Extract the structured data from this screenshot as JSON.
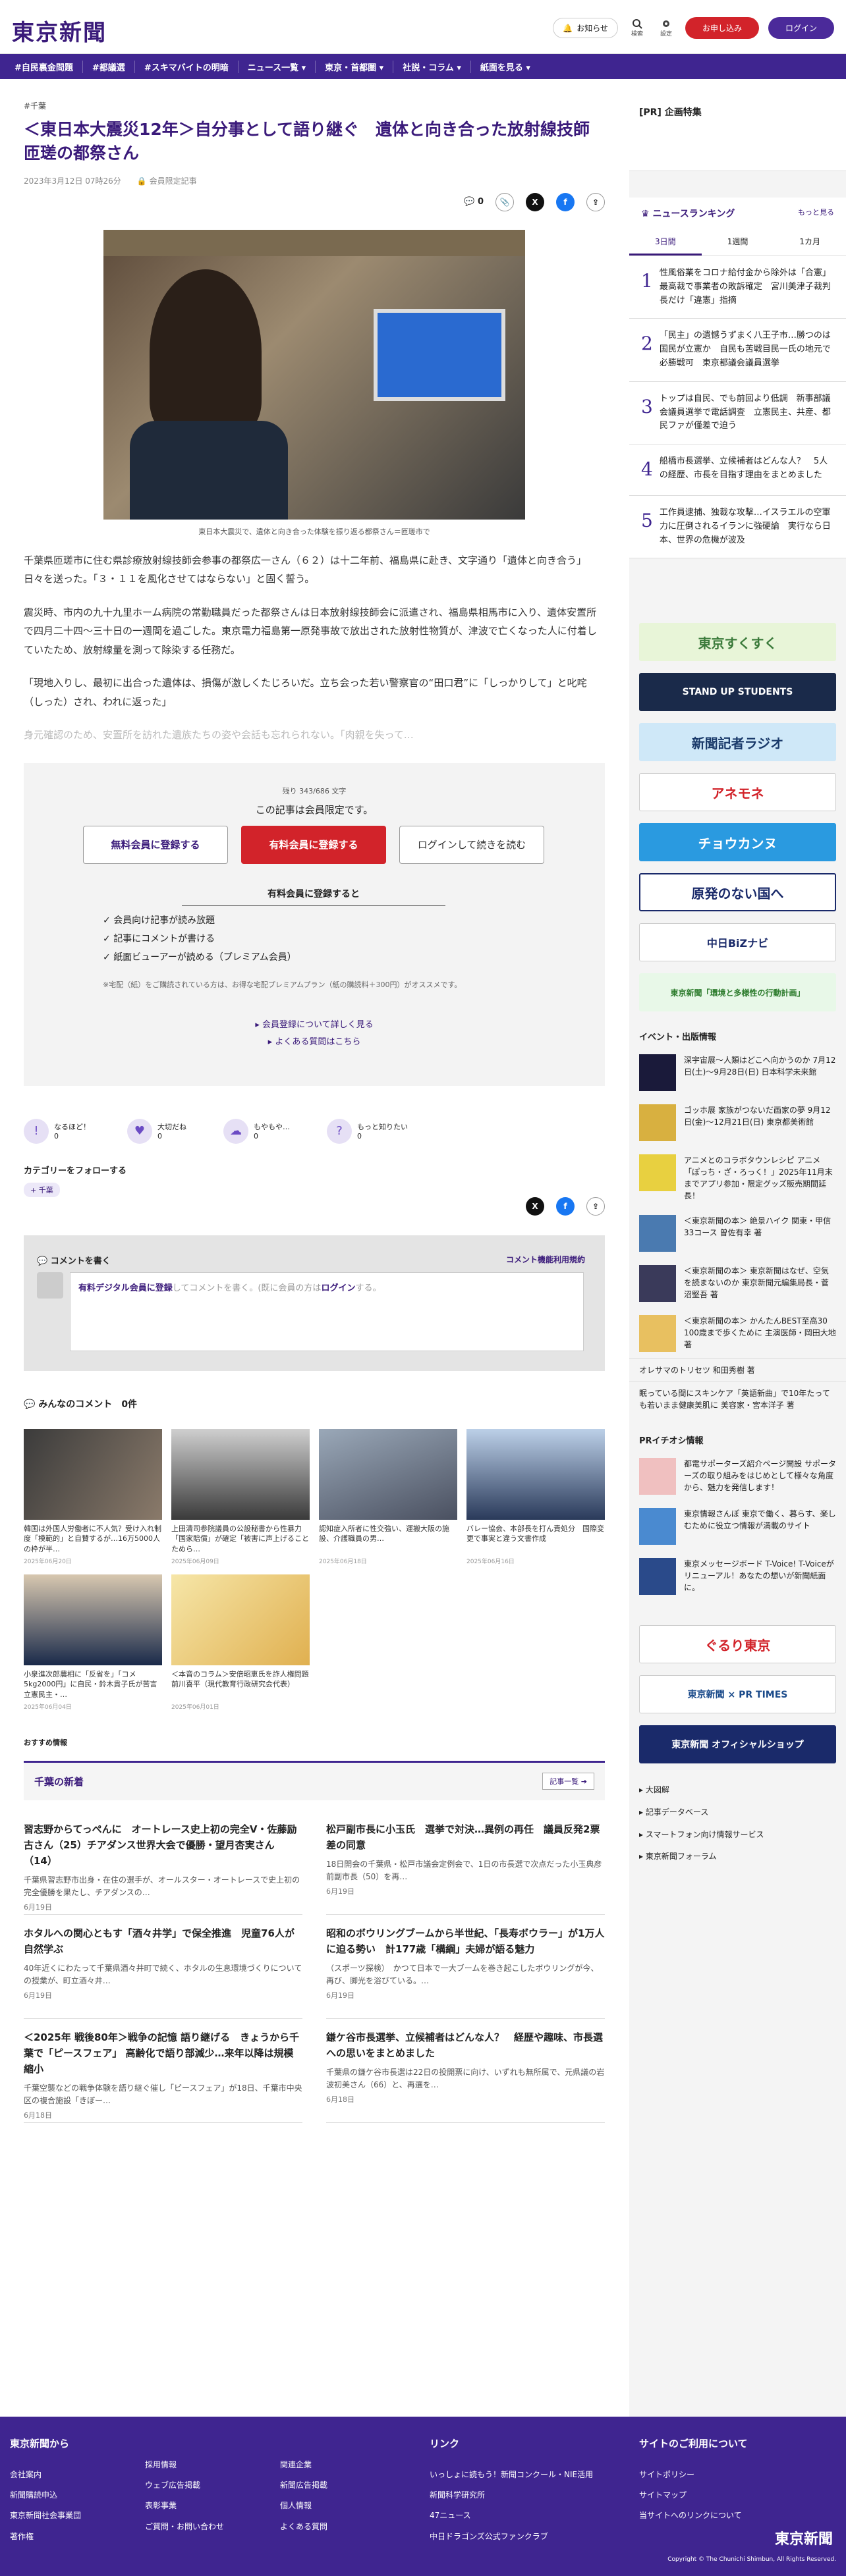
{
  "header": {
    "logo": "東京新聞",
    "notice": "お知らせ",
    "search": "検索",
    "settings": "設定",
    "register": "お申し込み",
    "login": "ログイン"
  },
  "nav": [
    "#自民裏金問題",
    "#都議選",
    "#スキマバイトの明暗",
    "ニュース一覧 ▾",
    "東京・首都圏 ▾",
    "社説・コラム ▾",
    "紙面を見る ▾"
  ],
  "article": {
    "tag": "#千葉",
    "title": "＜東日本大震災12年＞自分事として語り継ぐ　遺体と向き合った放射線技師　匝瑳の都祭さん",
    "date": "2023年3月12日 07時26分",
    "members": "会員限定記事",
    "comments": "0",
    "caption": "東日本大震災で、遺体と向き合った体験を振り返る都祭さん＝匝瑳市で",
    "p1": "千葉県匝瑳市に住む県診療放射線技師会参事の都祭広一さん（６２）は十二年前、福島県に赴き、文字通り「遺体と向き合う」日々を送った。「３・１１を風化させてはならない」と固く誓う。",
    "p2": "震災時、市内の九十九里ホーム病院の常勤職員だった都祭さんは日本放射線技師会に派遣され、福島県相馬市に入り、遺体安置所で四月二十四〜三十日の一週間を過ごした。東京電力福島第一原発事故で放出された放射性物質が、津波で亡くなった人に付着していたため、放射線量を測って除染する任務だ。",
    "p3": "「現地入りし、最初に出合った遺体は、損傷が激しくたじろいだ。立ち会った若い警察官の“田口君”に「しっかりして」と叱咤（しった）され、われに返った」",
    "p4": "身元確認のため、安置所を訪れた遺族たちの姿や会話も忘れられない。「肉親を失って…"
  },
  "paywall": {
    "remaining": "残り 343/686 文字",
    "notice": "この記事は会員限定です。",
    "free": "無料会員に登録する",
    "paid": "有料会員に登録する",
    "login": "ログインして続きを読む",
    "benefits_title": "有料会員に登録すると",
    "benefits": [
      "会員向け記事が読み放題",
      "記事にコメントが書ける",
      "紙面ビューアーが読める（プレミアム会員）"
    ],
    "note": "※宅配（紙）をご購読されている方は、お得な宅配プレミアムプラン（紙の購読料＋300円）がオススメです。",
    "link1": "会員登録について詳しく見る",
    "link2": "よくある質問はこちら"
  },
  "reactions": [
    {
      "label": "なるほど！",
      "count": "0"
    },
    {
      "label": "大切だね",
      "count": "0"
    },
    {
      "label": "もやもや…",
      "count": "0"
    },
    {
      "label": "もっと知りたい",
      "count": "0"
    }
  ],
  "category": {
    "heading": "カテゴリーをフォローする",
    "chip": "千葉"
  },
  "comment": {
    "heading": "コメントを書く",
    "policy": "コメント機能利用規約",
    "text_a": "有料デジタル会員に登録",
    "text_b": "してコメントを書く。(既に会員の方は",
    "text_c": "ログイン",
    "text_d": "する。"
  },
  "everyone": {
    "heading": "みんなのコメント",
    "count": "0件"
  },
  "thumbs": [
    {
      "t": "韓国は外国人労働者に不人気？受け入れ制度「模範的」と自賛するが…16万5000人の枠が半…",
      "d": "2025年06月20日"
    },
    {
      "t": "上田清司参院議員の公設秘書から性暴力「国家賠償」が確定「被害に声上げることためら…",
      "d": "2025年06月09日"
    },
    {
      "t": "認知症入所者に性交強い、運搬大阪の施設、介護職員の男…",
      "d": "2025年06月18日"
    },
    {
      "t": "バレー協会、本部長を打ん責処分　国際変更で事実と違う文書作成",
      "d": "2025年06月16日"
    },
    {
      "t": "小泉進次郎農相に「反省を」「コメ5kg2000円」に自民・鈴木貴子氏が苦言　立憲民主・…",
      "d": "2025年06月04日"
    },
    {
      "t": "＜本音のコラム＞安倍昭恵氏を詐人権問題　前川喜平（現代教育行政研究会代表）",
      "d": "2025年06月01日"
    }
  ],
  "recommend": "おすすめ情報",
  "chiba": {
    "heading": "千葉の新着",
    "more": "記事一覧",
    "items": [
      {
        "h": "習志野からてっぺんに　オートレース史上初の完全V・佐藤励古さん（25）チアダンス世界大会で優勝・望月杏実さん（14）",
        "p": "千葉県習志野市出身・在住の選手が、オールスター・オートレースで史上初の完全優勝を果たし、チアダンスの…",
        "d": "6月19日"
      },
      {
        "h": "松戸副市長に小玉氏　選挙で対決…異例の再任　議員反発2票差の同意",
        "p": "18日開会の千葉県・松戸市議会定例会で、1日の市長選で次点だった小玉典彦前副市長（50）を再…",
        "d": "6月19日"
      },
      {
        "h": "ホタルへの関心ともす「酒々井学」で保全推進　児童76人が自然学ぶ",
        "p": "40年近くにわたって千葉県酒々井町で続く、ホタルの生息環境づくりについての授業が、町立酒々井…",
        "d": "6月19日"
      },
      {
        "h": "昭和のボウリングブームから半世紀、「長寿ボウラー」が1万人に迫る勢い　計177歳「構綱」夫婦が語る魅力",
        "p": "（スポーツ探検）　かつて日本で一大ブームを巻き起こしたボウリングが今、再び、脚光を浴びている。…",
        "d": "6月19日"
      },
      {
        "h": "＜2025年 戦後80年＞戦争の記憶 語り継げる　きょうから千葉で「ピースフェア」 高齢化で語り部減少…来年以降は規模縮小",
        "p": "千葉空襲などの戦争体験を語り継ぐ催し「ピースフェア」が18日、千葉市中央区の複合施設「きぼー…",
        "d": "6月18日"
      },
      {
        "h": "鎌ケ谷市長選挙、立候補者はどんな人？　経歴や趣味、市長選への思いをまとめました",
        "p": "千葉県の鎌ケ谷市長選は22日の投開票に向け、いずれも無所属で、元県議の岩波初美さん（66）と、再選を…",
        "d": "6月18日"
      }
    ]
  },
  "side": {
    "pr": "[PR] 企画特集",
    "ranking": "ニュースランキング",
    "more": "もっと見る",
    "tabs": [
      "3日間",
      "1週間",
      "1カ月"
    ],
    "ranks": [
      "性風俗業をコロナ給付金から除外は「合憲」最高裁で事業者の敗訴確定　宮川美津子裁判長だけ「違憲」指摘",
      "「民主」の遺憾うずまく八王子市…勝つのは国民が立憲か　自民も苦戦目民一氏の地元で必勝戦可　東京都議会議員選挙",
      "トップは自民、でも前回より低調　新事部議会議員選挙で電話調査　立憲民主、共産、都民ファが僅差で迫う",
      "船橋市長選挙、立候補者はどんな人？　5人の経歴、市長を目指す理由をまとめました",
      "工作員逮捕、独裁な攻撃…イスラエルの空軍力に圧倒されるイランに強硬論　実行なら日本、世界の危機が波及"
    ],
    "ads": [
      "東京すくすく",
      "STAND UP STUDENTS",
      "新聞記者ラジオ",
      "アネモネ",
      "チョウカンヌ",
      "原発のない国へ",
      "中日BiZナビ",
      "東京新聞「環境と多様性の行動計画」"
    ],
    "events_h": "イベント・出版情報",
    "events": [
      "深宇宙展〜人類はどこへ向かうのか 7月12日(土)〜9月28日(日) 日本科学未来館",
      "ゴッホ展 家族がつないだ画家の夢 9月12日(金)〜12月21日(日) 東京都美術館",
      "アニメとのコラボタウンレシピ アニメ「ぽっち・ざ・ろっく！」2025年11月末までアプリ参加・限定グッズ販売期間延長！",
      "＜東京新聞の本＞ 絶景ハイク 関東・甲信33コース 曽佐有幸 著",
      "＜東京新聞の本＞ 東京新聞はなぜ、空気を読まないのか 東京新聞元編集局長・菅沼堅吾 著",
      "＜東京新聞の本＞ かんたんBEST至高30　100歳まで歩くために 主演医師・岡田大地 著"
    ],
    "extra": [
      "オレサマのトリセツ 和田秀樹 著",
      "眠っている間にスキンケア「英語新曲」で10年たっても若いまま健康美肌に 美容家・宮本洋子 著"
    ],
    "pr2": "PRイチオシ情報",
    "pr_items": [
      "都電サポーターズ紹介ページ開設 サポーターズの取り組みをはじめとして様々な角度から、魅力を発信します！",
      "東京情報さんぽ 東京で働く、暮らす、楽しむために役立つ情報が満載のサイト",
      "東京メッセージボード T-Voice! T-Voiceがリニューアル！あなたの想いが新聞紙面に。"
    ],
    "banners": [
      "ぐるり東京",
      "東京新聞 × PR TIMES",
      "東京新聞 オフィシャルショップ"
    ],
    "links": [
      "大図解",
      "記事データベース",
      "スマートフォン向け情報サービス",
      "東京新聞フォーラム"
    ]
  },
  "footer": {
    "c1h": "東京新聞から",
    "c1": [
      "会社案内",
      "新聞購読申込",
      "東京新聞社会事業団",
      "著作権"
    ],
    "c2": [
      "採用情報",
      "ウェブ広告掲載",
      "表彰事業",
      "ご質問・お問い合わせ"
    ],
    "c3": [
      "関連企業",
      "新聞広告掲載",
      "個人情報",
      "よくある質問"
    ],
    "c4h": "リンク",
    "c4": [
      "いっしょに読もう！新聞コンクール・NIE活用",
      "新聞科学研究所",
      "47ニュース",
      "中日ドラゴンズ公式ファンクラブ"
    ],
    "c5h": "サイトのご利用について",
    "c5": [
      "サイトポリシー",
      "サイトマップ",
      "当サイトへのリンクについて"
    ],
    "logo": "東京新聞",
    "copy": "Copyright © The Chunichi Shimbun, All Rights Reserved."
  }
}
